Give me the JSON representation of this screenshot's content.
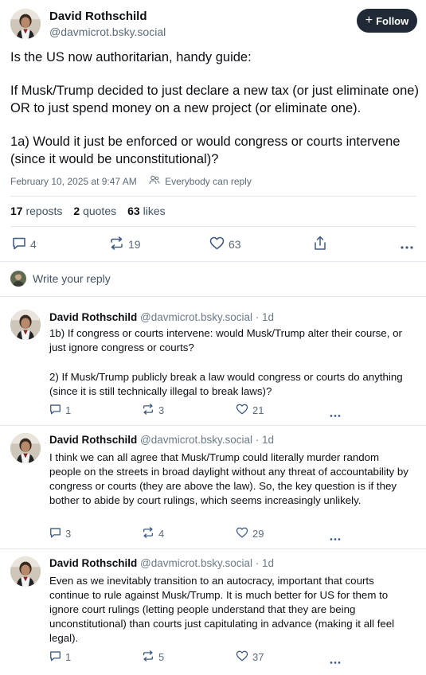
{
  "main_post": {
    "author_name": "David Rothschild",
    "author_handle": "@davmicrot.bsky.social",
    "follow_label": "Follow",
    "paragraphs": [
      "Is the US now authoritarian, handy guide:",
      "If Musk/Trump decided to just declare a new tax (or just eliminate one) OR to just spend money on a new project (or eliminate one).",
      "1a) Would it just be enforced or would congress or courts intervene (since it would be unconstitutional)?"
    ],
    "timestamp": "February 10, 2025 at 9:47 AM",
    "reply_setting": "Everybody can reply",
    "stats": {
      "reposts_count": "17",
      "reposts_label": "reposts",
      "quotes_count": "2",
      "quotes_label": "quotes",
      "likes_count": "63",
      "likes_label": "likes"
    },
    "actions": {
      "replies": "4",
      "reposts": "19",
      "likes": "63"
    }
  },
  "reply_prompt": "Write your reply",
  "replies": [
    {
      "author_name": "David Rothschild",
      "author_handle": "@davmicrot.bsky.social",
      "time": "· 1d",
      "paragraphs": [
        "1b) If congress or courts intervene: would Musk/Trump alter their course, or just ignore congress or courts?",
        "2) If Musk/Trump publicly break a law would congress or courts do anything (since it is still technically illegal to break laws)?"
      ],
      "replies": "1",
      "reposts": "3",
      "likes": "21"
    },
    {
      "author_name": "David Rothschild",
      "author_handle": "@davmicrot.bsky.social",
      "time": "· 1d",
      "paragraphs": [
        "I think we can all agree that Musk/Trump could literally murder random people on the streets in broad daylight without any threat of accountability by congress or courts (they are above the law). So, the key question is if they bother to abide by court rulings, which seems increasingly unlikely."
      ],
      "replies": "3",
      "reposts": "4",
      "likes": "29"
    },
    {
      "author_name": "David Rothschild",
      "author_handle": "@davmicrot.bsky.social",
      "time": "· 1d",
      "paragraphs": [
        "Even as we inevitably transition to an autocracy, important that courts continue to rule against Musk/Trump. It is much better for US for them to ignore court rulings (letting people understand that they are being unconstitutional) than courts just capitulating in advance (making it all feel legal)."
      ],
      "replies": "1",
      "reposts": "5",
      "likes": "37"
    }
  ],
  "icons": {
    "reply": "reply-icon",
    "repost": "repost-icon",
    "like": "heart-icon",
    "share": "share-icon",
    "more": "more-icon",
    "plus": "plus-icon",
    "people": "people-icon"
  },
  "colors": {
    "follow_bg": "#1f2a36",
    "muted_text": "#5b6b7a",
    "divider": "#e3e8ee"
  }
}
